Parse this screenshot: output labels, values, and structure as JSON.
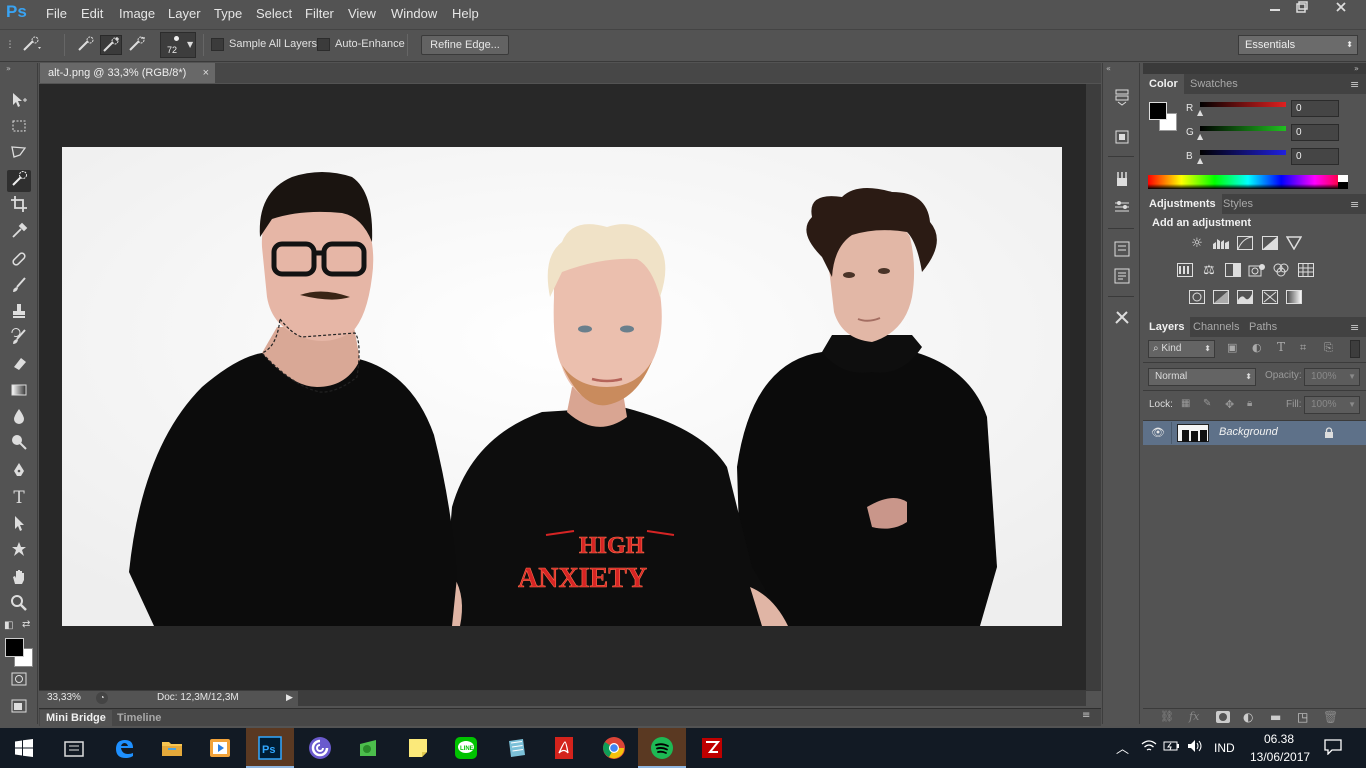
{
  "app": {
    "logo": "Ps",
    "menu": [
      "File",
      "Edit",
      "Image",
      "Layer",
      "Type",
      "Select",
      "Filter",
      "View",
      "Window",
      "Help"
    ],
    "window_controls": [
      "minimize-icon",
      "restore-icon",
      "close-icon"
    ]
  },
  "options_bar": {
    "brush_size": "72",
    "sample_all_layers": "Sample All Layers",
    "auto_enhance": "Auto-Enhance",
    "refine_edge": "Refine Edge...",
    "workspace": "Essentials"
  },
  "document": {
    "tab_title": "alt-J.png @ 33,3% (RGB/8*)",
    "tab_close": "×",
    "zoom": "33,33%",
    "doc_size": "Doc: 12,3M/12,3M",
    "shirt_text_line1": "HIGH",
    "shirt_text_line2": "ANXIETY"
  },
  "bottom_tabs": [
    "Mini Bridge",
    "Timeline"
  ],
  "color_panel": {
    "tabs": [
      "Color",
      "Swatches"
    ],
    "channels": [
      {
        "label": "R",
        "value": "0",
        "color": "#e02020"
      },
      {
        "label": "G",
        "value": "0",
        "color": "#20c020"
      },
      {
        "label": "B",
        "value": "0",
        "color": "#2020e0"
      }
    ]
  },
  "adjustments_panel": {
    "tabs": [
      "Adjustments",
      "Styles"
    ],
    "title": "Add an adjustment",
    "row1_icons": [
      "brightness-icon",
      "levels-icon",
      "curves-icon",
      "exposure-icon",
      "vibrance-icon"
    ],
    "row2_icons": [
      "hue-saturation-icon",
      "color-balance-icon",
      "black-white-icon",
      "photo-filter-icon",
      "channel-mixer-icon",
      "color-lookup-icon"
    ],
    "row3_icons": [
      "invert-icon",
      "posterize-icon",
      "threshold-icon",
      "selective-color-icon",
      "gradient-map-icon"
    ]
  },
  "layers_panel": {
    "tabs": [
      "Layers",
      "Channels",
      "Paths"
    ],
    "filter_kind": "Kind",
    "blend_mode": "Normal",
    "opacity_label": "Opacity:",
    "opacity_value": "100%",
    "lock_label": "Lock:",
    "fill_label": "Fill:",
    "fill_value": "100%",
    "layers": [
      {
        "name": "Background",
        "visible": true,
        "locked": true
      }
    ],
    "footer_icons": [
      "link-icon",
      "fx-icon",
      "mask-icon",
      "adjustment-layer-icon",
      "group-icon",
      "new-layer-icon",
      "trash-icon"
    ]
  },
  "taskbar": {
    "apps": [
      "file-explorer",
      "edge",
      "folder",
      "media-player",
      "photoshop",
      "bittorrent",
      "android-app",
      "sticky-notes",
      "line",
      "notes",
      "acrobat",
      "chrome",
      "spotify",
      "filezilla"
    ],
    "language": "IND",
    "time": "06.38",
    "date": "13/06/2017"
  }
}
